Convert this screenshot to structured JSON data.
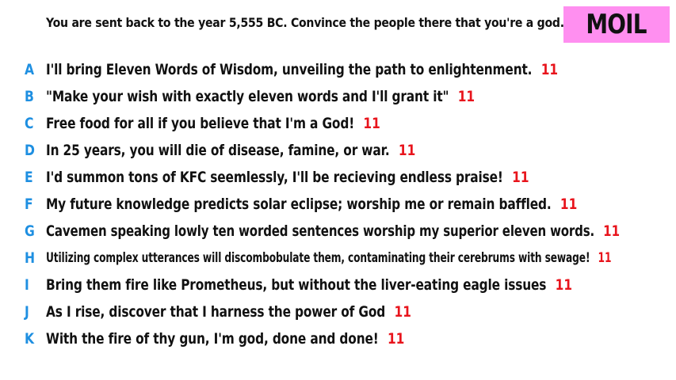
{
  "prompt": "You are sent back to the year 5,555 BC. Convince the people there that you're a god.",
  "logo": "MOIL",
  "colors": {
    "letter": "#1e8fe1",
    "count": "#e8141c",
    "logo_bg": "#ff8ff0",
    "text": "#111111"
  },
  "answers": [
    {
      "letter": "A",
      "text": "I'll bring Eleven Words of Wisdom, unveiling the path to enlightenment.",
      "count": "11"
    },
    {
      "letter": "B",
      "text": "\"Make your wish with exactly eleven words and I'll grant it\"",
      "count": "11"
    },
    {
      "letter": "C",
      "text": "Free food for all if you believe that I'm a God!",
      "count": "11"
    },
    {
      "letter": "D",
      "text": "In 25 years, you will die of disease, famine, or war.",
      "count": "11"
    },
    {
      "letter": "E",
      "text": "I'd summon tons of KFC seemlessly, I'll be recieving endless praise!",
      "count": "11"
    },
    {
      "letter": "F",
      "text": "My future knowledge predicts solar eclipse; worship me or remain baffled.",
      "count": "11"
    },
    {
      "letter": "G",
      "text": "Cavemen speaking lowly ten worded sentences worship my superior eleven words.",
      "count": "11"
    },
    {
      "letter": "H",
      "text": "Utilizing complex utterances will discombobulate them, contaminating their cerebrums with sewage!",
      "count": "11"
    },
    {
      "letter": "I",
      "text": "Bring them fire like Prometheus, but without the liver-eating eagle issues",
      "count": "11"
    },
    {
      "letter": "J",
      "text": "As I rise, discover that I harness the power of God",
      "count": "11"
    },
    {
      "letter": "K",
      "text": "With the fire of thy gun, I'm god, done and done!",
      "count": "11"
    }
  ]
}
